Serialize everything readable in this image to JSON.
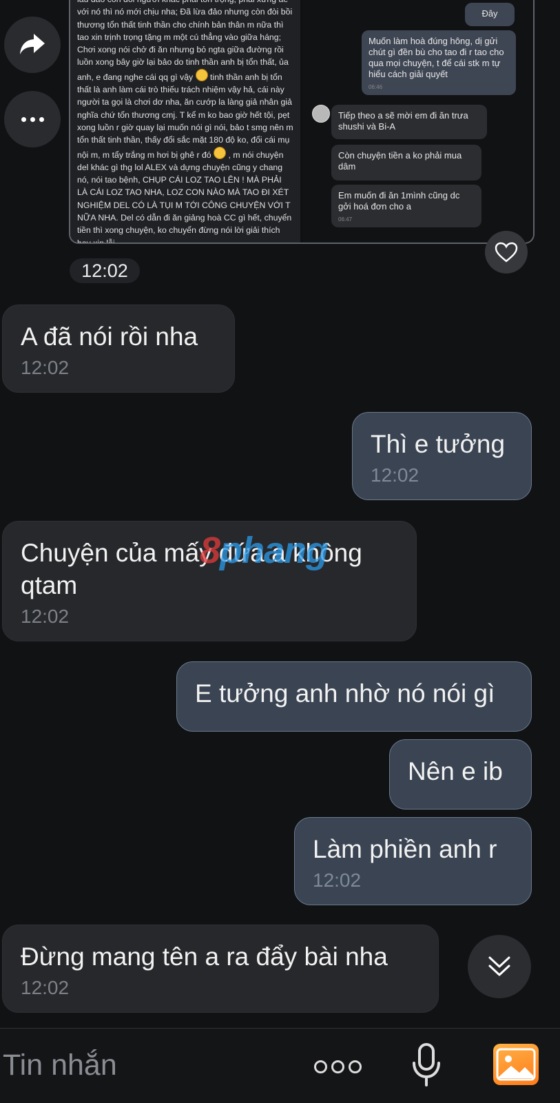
{
  "shared_image": {
    "left_text_prefix": "lau dao con doi người khác phải tôn trọng, phải xưng ae với nó thì nó mới chịu nha; Đã lừa đảo nhưng còn đòi bồi thương tổn thất tinh thần cho chính bản thân m nữa thì tao xin trịnh trọng tặng m một cú thẳng vào giữa háng; Chơi xong nói chở đi ăn nhưng bỏ ngta giữa đường rồi luồn xong bây giờ lại bảo do tinh thần anh bị tổn thất, ủa anh, e đang nghe cái qq gì vậy",
    "left_text_middle": " tinh thần anh bị tổn thất là anh làm cái trò thiếu trách nhiệm vậy hả, cái này người ta gọi là chơi dơ nha, ăn cướp la làng giả nhân giả nghĩa chứ tổn thương cmj. T kể m ko bao giờ hết tội, pẹt xong luồn r giờ quay lại muốn nói gì nói, bảo t smg nên m tổn thất tinh thần, thấy đổi sắc mặt 180 độ ko, đổi cái mụ nội m, m tẩy trắng m hơi bị ghê r đó",
    "left_text_suffix": ", m nói chuyện del khác gì thg lol ALEX và dựng chuyện cũng y chang nó, nói tao bệnh, CHỤP CÁI LOZ TAO LÊN ! MÀ PHẢI LÀ CÁI LOZ TAO NHA, LOZ CON NÀO MÀ TAO ĐI XÉT NGHIỆM DEL CÓ LÀ TỤI M TỚI CÔNG CHUYỆN VỚI T NỮA NHA. Del có dẫn đi ăn giảng hoà CC gì hết, chuyển tiền thì xong chuyện, ko chuyển đừng nói lời giải thích hay xin lỗi",
    "right_msgs": {
      "day": "Đây",
      "muon": "Muốn làm hoà đúng hông, dị gửi chút gì đền bù cho tao đi r tao cho qua mọi chuyện, t để cái stk m tự hiểu cách giải quyết",
      "muon_time": "06:46",
      "tiep": "Tiếp theo a sẽ mời em đi ăn trưa shushi và Bi-A",
      "con": "Còn chuyện tiền a ko phải mua dâm",
      "em": "Em muốn đi ăn 1mình cũng dc gởi hoá đơn cho a",
      "em_time": "06:47"
    }
  },
  "date_chip": "12:02",
  "messages": [
    {
      "dir": "in",
      "text": "A đã nói rồi nha",
      "time": "12:02"
    },
    {
      "dir": "out",
      "text": "Thì e tưởng",
      "time": "12:02"
    },
    {
      "dir": "in",
      "text": "Chuyện của mấy đứa a không qtam",
      "time": "12:02"
    },
    {
      "dir": "out",
      "text": "E tưởng anh nhờ nó nói gì",
      "time": ""
    },
    {
      "dir": "out",
      "text": "Nên e ib",
      "time": ""
    },
    {
      "dir": "out",
      "text": "Làm phiền anh r",
      "time": "12:02"
    },
    {
      "dir": "in",
      "text": "Đừng mang tên a ra đẩy bài nha",
      "time": "12:02"
    }
  ],
  "watermark": {
    "part1": "8",
    "part2": "phang"
  },
  "composer": {
    "placeholder": "Tin nhắn"
  },
  "icons": {
    "share": "share-icon",
    "more": "more-icon",
    "heart": "heart-icon",
    "scroll_down": "chevron-double-down-icon",
    "mic": "mic-icon",
    "gallery": "gallery-icon"
  },
  "colors": {
    "background": "#111214",
    "incoming": "#27282b",
    "outgoing": "#3a4452"
  }
}
